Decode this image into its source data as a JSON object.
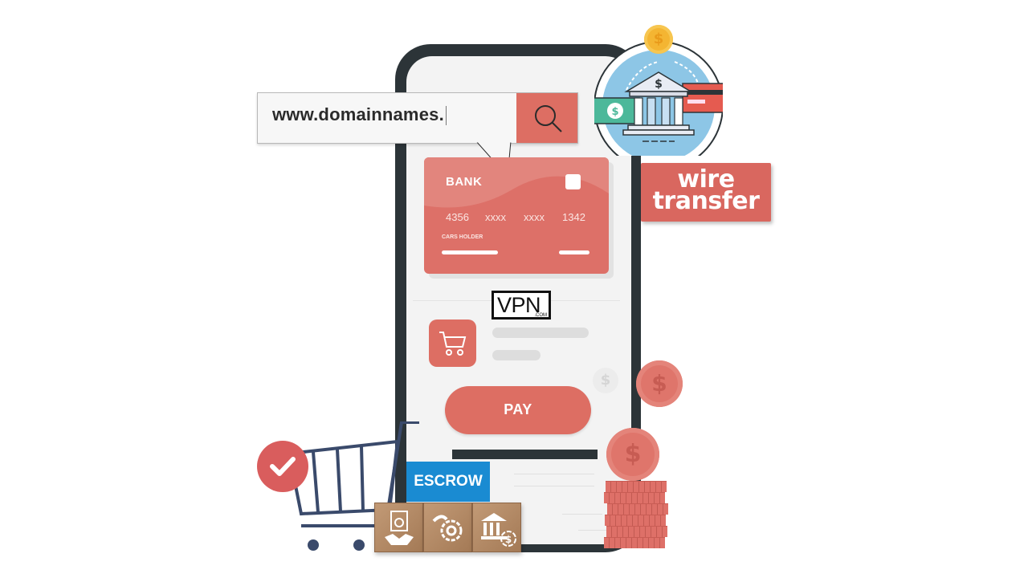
{
  "search": {
    "value": "www.domainnames.",
    "button_icon": "search-icon"
  },
  "card": {
    "bank_label": "BANK",
    "number_groups": [
      "4356",
      "xxxx",
      "xxxx",
      "1342"
    ],
    "holder_label": "CARS HOLDER"
  },
  "badges": {
    "wire_line1": "wire",
    "wire_line2": "transfer",
    "escrow": "ESCROW"
  },
  "logo": {
    "name": "VPN",
    "suffix": ".COM"
  },
  "phone": {
    "pay_label": "PAY"
  },
  "coins": {
    "symbol": "$"
  },
  "colors": {
    "accent": "#dd6e63",
    "phone_frame": "#2c3438",
    "escrow_blue": "#1a8bd2",
    "check_red": "#d95d5d"
  }
}
